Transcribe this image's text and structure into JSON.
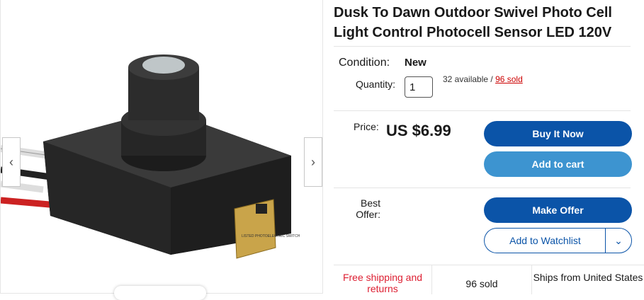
{
  "gallery": {
    "prev_glyph": "‹",
    "next_glyph": "›",
    "label_text": "LISTED PHOTOELECTRIC SWITCH"
  },
  "listing": {
    "title": "Dusk To Dawn Outdoor Swivel Photo Cell Light Control Photocell Sensor LED 120V",
    "condition_label": "Condition:",
    "condition_value": "New",
    "quantity_label": "Quantity:",
    "quantity_value": "1",
    "available_text": "32 available / ",
    "sold_link": "96 sold",
    "price_label": "Price:",
    "price_value": "US $6.99",
    "best_offer_label": "Best Offer:"
  },
  "buttons": {
    "buy_now": "Buy It Now",
    "add_to_cart": "Add to cart",
    "make_offer": "Make Offer",
    "add_to_watchlist": "Add to Watchlist",
    "watchlist_dropdown_glyph": "⌄"
  },
  "tiles": {
    "shipping": "Free shipping and returns",
    "sold": "96 sold",
    "ships_from": "Ships from United States"
  },
  "colors": {
    "primary_blue": "#0b54a8",
    "secondary_blue": "#3d94d0",
    "red_link": "#c00",
    "shipping_red": "#dd1e31"
  }
}
